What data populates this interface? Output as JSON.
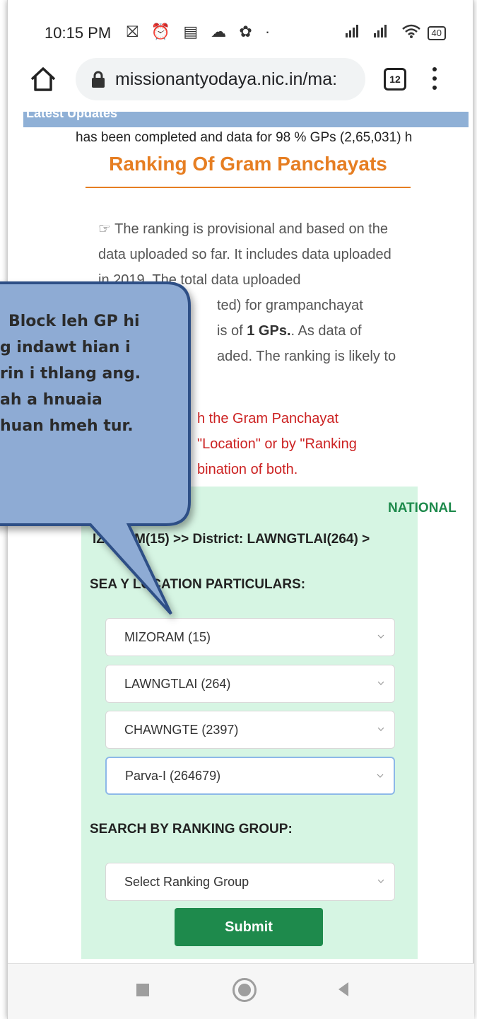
{
  "status_bar": {
    "time": "10:15 PM",
    "left_icons": "⛝ ⏰ ▤ ☁ ✿ ·",
    "battery": "40"
  },
  "browser": {
    "url": "missionantyodaya.nic.in/ma:",
    "tab_count": "12"
  },
  "page": {
    "latest_label": "Latest Updates",
    "ticker": "has been completed and data for 98 % GPs (2,65,031) h",
    "title": "Ranking Of Gram Panchayats",
    "para_icon": "☞",
    "para_1": " The ranking is provisional and based on the data uploaded so far. It includes data uploaded in 2019. The total data uploaded",
    "para_2": "ted) for grampanchayat",
    "para_3a": "is of ",
    "para_3b": "1 GPs.",
    "para_3c": ". As data of",
    "para_4": "aded. The ranking is likely to",
    "para_red_1": "h the Gram Panchayat",
    "para_red_2": "\"Location\" or by \"Ranking",
    "para_red_3": "bination of both.",
    "national": "NATIONAL",
    "breadcrumb": "IZORAM(15) >> District: LAWNGTLAI(264) >",
    "search_location_heading": "SEA          Y LOCATION PARTICULARS:",
    "selects": [
      {
        "value": "MIZORAM (15)"
      },
      {
        "value": "LAWNGTLAI (264)"
      },
      {
        "value": "CHAWNGTE (2397)"
      },
      {
        "value": "Parva-I (264679)"
      }
    ],
    "ranking_group_heading": "SEARCH BY RANKING GROUP:",
    "ranking_group_placeholder": "Select Ranking Group",
    "submit": "Submit"
  },
  "callout": {
    "lines": [
      "Block leh GP hi",
      "g indawt hian i",
      "rin i thlang ang.",
      "ah a hnuaia",
      "huan hmeh tur."
    ],
    "fill": "#8eabd4",
    "stroke": "#2f4f86"
  }
}
